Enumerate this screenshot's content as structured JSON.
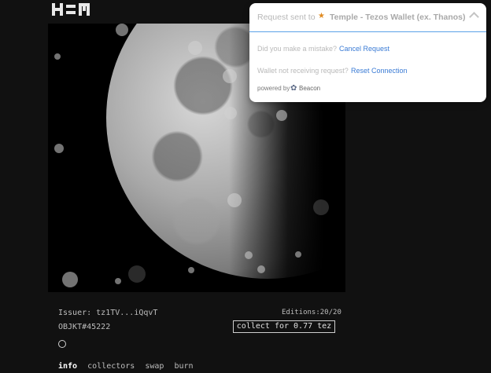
{
  "header": {
    "logo_icon": "hen-logo-icon"
  },
  "artwork": {
    "description_icon": "moon-image"
  },
  "objkt": {
    "issuer_label": "Issuer: tz1TV...iQqvT",
    "editions": "Editions:20/20",
    "objkt_id": "OBJKT#45222",
    "collect_label": "collect for 0.77 tez",
    "status_icon": "circle-outline-icon"
  },
  "tabs": [
    {
      "label": "info",
      "active": true
    },
    {
      "label": "collectors"
    },
    {
      "label": "swap"
    },
    {
      "label": "burn"
    }
  ],
  "beacon": {
    "request_prefix": "Request sent to",
    "wallet_icon": "temple-wallet-icon",
    "wallet_name": "Temple - Tezos Wallet (ex. Thanos)",
    "collapse_icon": "chevron-up-icon",
    "mistake_question": "Did you make a mistake?",
    "cancel_label": "Cancel Request",
    "receiving_question": "Wallet not receiving request?",
    "reset_label": "Reset Connection",
    "powered_by": "powered by",
    "beacon_icon": "beacon-logo-icon",
    "beacon_name": "Beacon",
    "accent_color": "#3a7bd5"
  }
}
